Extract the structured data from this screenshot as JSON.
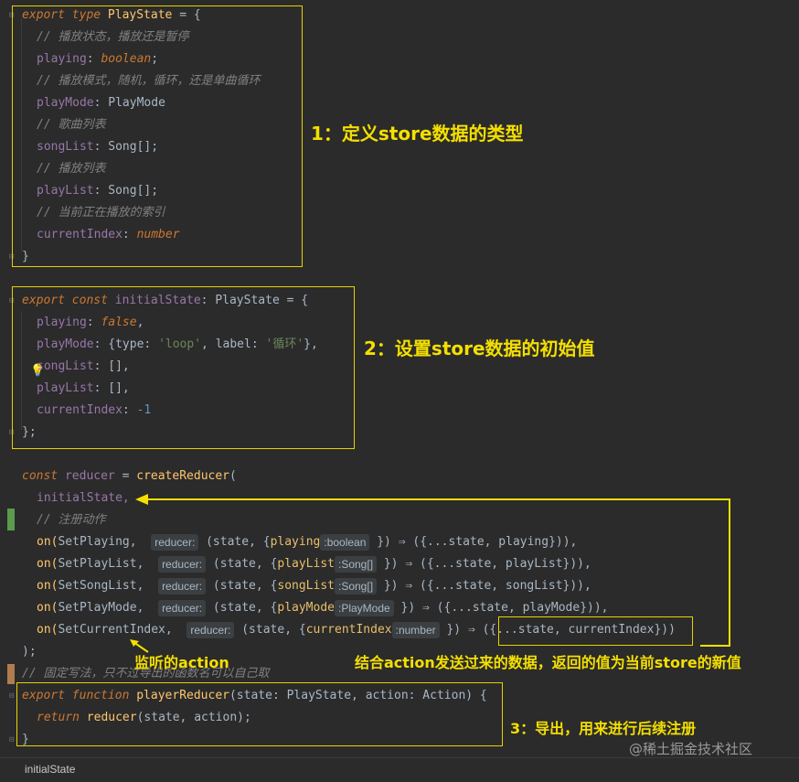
{
  "code": {
    "l1": {
      "kw": "export type",
      "name": "PlayState",
      "rest": " = {"
    },
    "l2": "// 播放状态，播放还是暂停",
    "l3": {
      "prop": "playing",
      "type": "boolean"
    },
    "l4": "// 播放模式，随机，循环，还是单曲循环",
    "l5": {
      "prop": "playMode",
      "type": "PlayMode"
    },
    "l6": "// 歌曲列表",
    "l7": {
      "prop": "songList",
      "type": "Song[]"
    },
    "l8": "// 播放列表",
    "l9": {
      "prop": "playList",
      "type": "Song[]"
    },
    "l10": "// 当前正在播放的索引",
    "l11": {
      "prop": "currentIndex",
      "type": "number"
    },
    "l12": "}",
    "l13": {
      "kw": "export const",
      "name": "initialState",
      "type": "PlayState",
      "rest": " = {"
    },
    "l14": {
      "prop": "playing",
      "val": "false"
    },
    "l15": {
      "prop": "playMode",
      "a": "{type: ",
      "s1": "'loop'",
      "b": ", label: ",
      "s2": "'循环'",
      "c": "},"
    },
    "l16": {
      "prop": "songList",
      "val": "[],"
    },
    "l17": {
      "prop": "playList",
      "val": "[],"
    },
    "l18": {
      "prop": "currentIndex",
      "val": "-1"
    },
    "l19": "};",
    "l20": {
      "kw": "const",
      "name": "reducer",
      "fn": "createReducer",
      "rest": "("
    },
    "l21": "initialState,",
    "l22": "// 注册动作",
    "ons": [
      {
        "action": "SetPlaying",
        "key": "playing",
        "ktype": ":boolean",
        "rest": "({...state, playing})),"
      },
      {
        "action": "SetPlayList",
        "key": "playList",
        "ktype": ":Song[]",
        "rest": "({...state, playList})),"
      },
      {
        "action": "SetSongList",
        "key": "songList",
        "ktype": ":Song[]",
        "rest": "({...state, songList})),"
      },
      {
        "action": "SetPlayMode",
        "key": "playMode",
        "ktype": ":PlayMode",
        "rest": "({...state, playMode})),"
      },
      {
        "action": "SetCurrentIndex",
        "key": "currentIndex",
        "ktype": ":number",
        "rest": "({...state, currentIndex}))"
      }
    ],
    "on_label": "on(",
    "reducer_hint": "reducer:",
    "state_open": "(state, {",
    "close_arrow": "}) ⇒ ",
    "l28": ");",
    "l29": "// 固定写法，只不过导出的函数名可以自己取",
    "l30": {
      "kw": "export function",
      "name": "playerReducer",
      "sig": "(state: PlayState, action: Action) {"
    },
    "l31": {
      "kw": "return",
      "call": "reducer",
      "args": "(state, action);"
    },
    "l32": "}"
  },
  "annotations": {
    "a1": "1：定义store数据的类型",
    "a2": "2：设置store数据的初始值",
    "a3": "3：导出，用来进行后续注册",
    "listen": "监听的action",
    "combine": "结合action发送过来的数据，返回的值为当前store的新值"
  },
  "status_bar": {
    "text": "initialState"
  },
  "watermark": "@稀土掘金技术社区",
  "colors": {
    "annotation": "#f4df00",
    "background": "#2b2b2b"
  }
}
